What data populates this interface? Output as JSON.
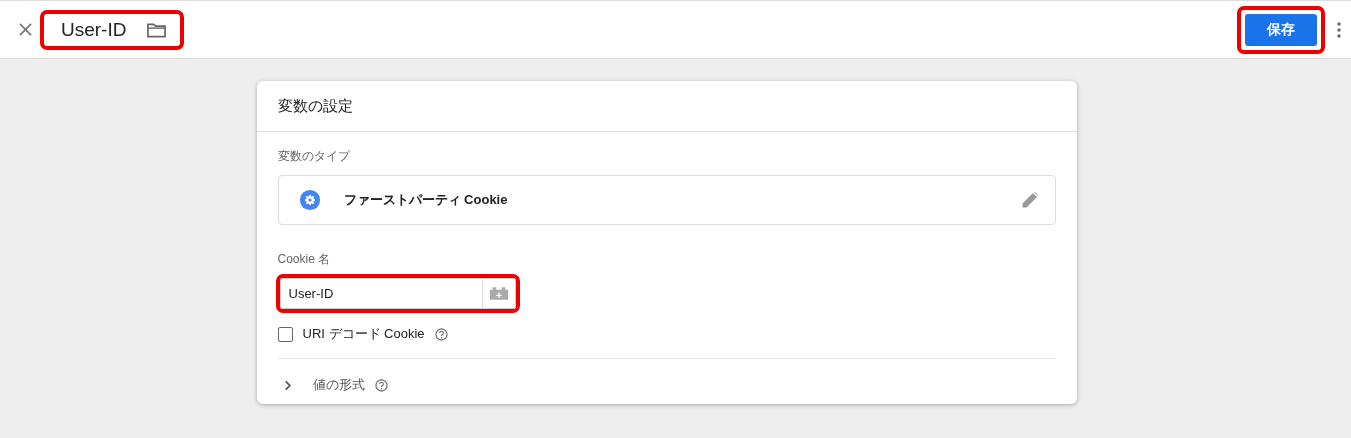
{
  "header": {
    "title": "User-ID",
    "title_highlighted": true,
    "save_label": "保存",
    "save_highlighted": true
  },
  "card": {
    "title": "変数の設定",
    "type_label": "変数のタイプ",
    "type_name": "ファーストパーティ Cookie",
    "cookie_label": "Cookie 名",
    "cookie_value": "User-ID",
    "cookie_highlighted": true,
    "uri_decode": {
      "label": "URI デコード Cookie",
      "checked": false
    },
    "format": {
      "label": "値の形式",
      "expanded": false
    }
  }
}
